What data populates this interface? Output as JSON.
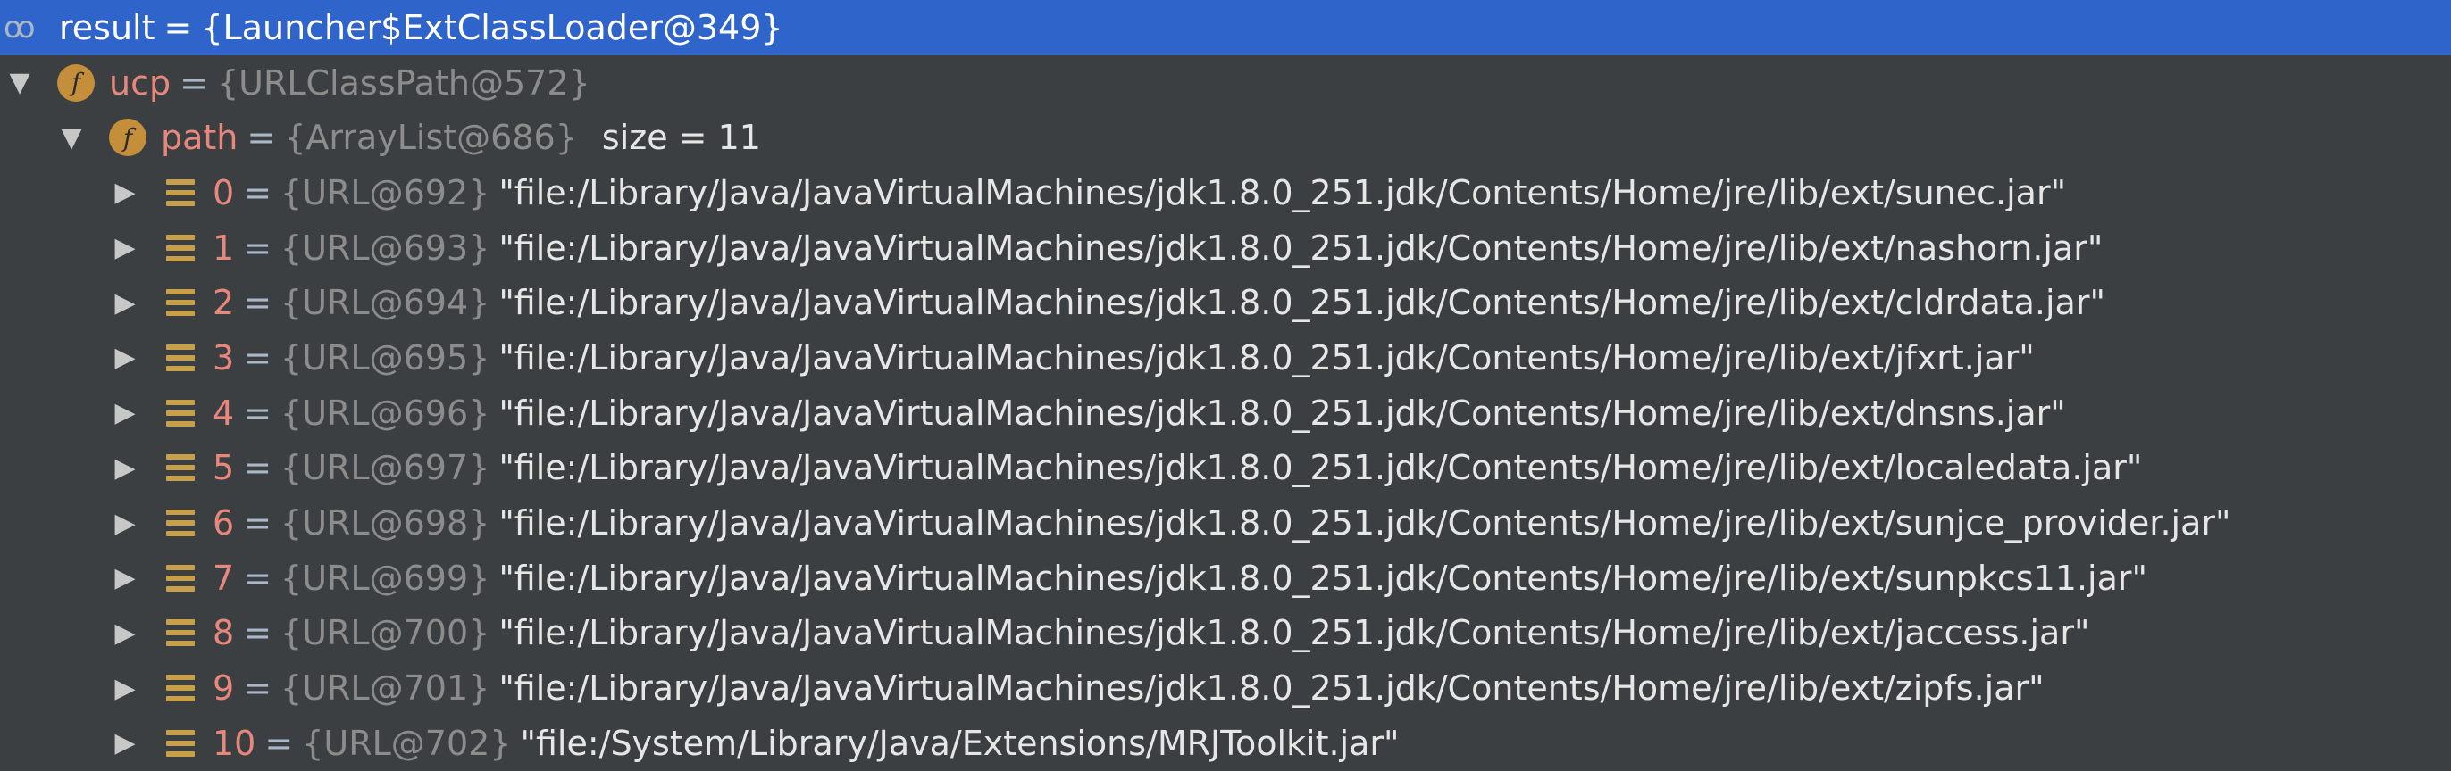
{
  "debug_tree": {
    "root": {
      "name": "result",
      "equals": "=",
      "ref": "{Launcher$ExtClassLoader@349}",
      "icon": "watch-glasses-icon"
    },
    "ucp": {
      "name": "ucp",
      "equals": "=",
      "ref": "{URLClassPath@572}",
      "icon": "field-icon",
      "expanded": true
    },
    "path": {
      "name": "path",
      "equals": "=",
      "ref": "{ArrayList@686}",
      "extra": "size = 11",
      "icon": "field-icon",
      "expanded": true
    },
    "items": [
      {
        "index": "0",
        "equals": "=",
        "ref": "{URL@692}",
        "value": "\"file:/Library/Java/JavaVirtualMachines/jdk1.8.0_251.jdk/Contents/Home/jre/lib/ext/sunec.jar\""
      },
      {
        "index": "1",
        "equals": "=",
        "ref": "{URL@693}",
        "value": "\"file:/Library/Java/JavaVirtualMachines/jdk1.8.0_251.jdk/Contents/Home/jre/lib/ext/nashorn.jar\""
      },
      {
        "index": "2",
        "equals": "=",
        "ref": "{URL@694}",
        "value": "\"file:/Library/Java/JavaVirtualMachines/jdk1.8.0_251.jdk/Contents/Home/jre/lib/ext/cldrdata.jar\""
      },
      {
        "index": "3",
        "equals": "=",
        "ref": "{URL@695}",
        "value": "\"file:/Library/Java/JavaVirtualMachines/jdk1.8.0_251.jdk/Contents/Home/jre/lib/ext/jfxrt.jar\""
      },
      {
        "index": "4",
        "equals": "=",
        "ref": "{URL@696}",
        "value": "\"file:/Library/Java/JavaVirtualMachines/jdk1.8.0_251.jdk/Contents/Home/jre/lib/ext/dnsns.jar\""
      },
      {
        "index": "5",
        "equals": "=",
        "ref": "{URL@697}",
        "value": "\"file:/Library/Java/JavaVirtualMachines/jdk1.8.0_251.jdk/Contents/Home/jre/lib/ext/localedata.jar\""
      },
      {
        "index": "6",
        "equals": "=",
        "ref": "{URL@698}",
        "value": "\"file:/Library/Java/JavaVirtualMachines/jdk1.8.0_251.jdk/Contents/Home/jre/lib/ext/sunjce_provider.jar\""
      },
      {
        "index": "7",
        "equals": "=",
        "ref": "{URL@699}",
        "value": "\"file:/Library/Java/JavaVirtualMachines/jdk1.8.0_251.jdk/Contents/Home/jre/lib/ext/sunpkcs11.jar\""
      },
      {
        "index": "8",
        "equals": "=",
        "ref": "{URL@700}",
        "value": "\"file:/Library/Java/JavaVirtualMachines/jdk1.8.0_251.jdk/Contents/Home/jre/lib/ext/jaccess.jar\""
      },
      {
        "index": "9",
        "equals": "=",
        "ref": "{URL@701}",
        "value": "\"file:/Library/Java/JavaVirtualMachines/jdk1.8.0_251.jdk/Contents/Home/jre/lib/ext/zipfs.jar\""
      },
      {
        "index": "10",
        "equals": "=",
        "ref": "{URL@702}",
        "value": "\"file:/System/Library/Java/Extensions/MRJToolkit.jar\""
      }
    ],
    "glyphs": {
      "expanded_arrow": "▼",
      "collapsed_arrow": "▶",
      "field_letter": "f",
      "watch": "oo"
    },
    "colors": {
      "background": "#3c3f41",
      "selection": "#2f65ca",
      "field_name": "#e8877c",
      "reference": "#8c8c8c",
      "field_badge": "#c58e3b",
      "list_badge": "#c9a04a"
    }
  }
}
